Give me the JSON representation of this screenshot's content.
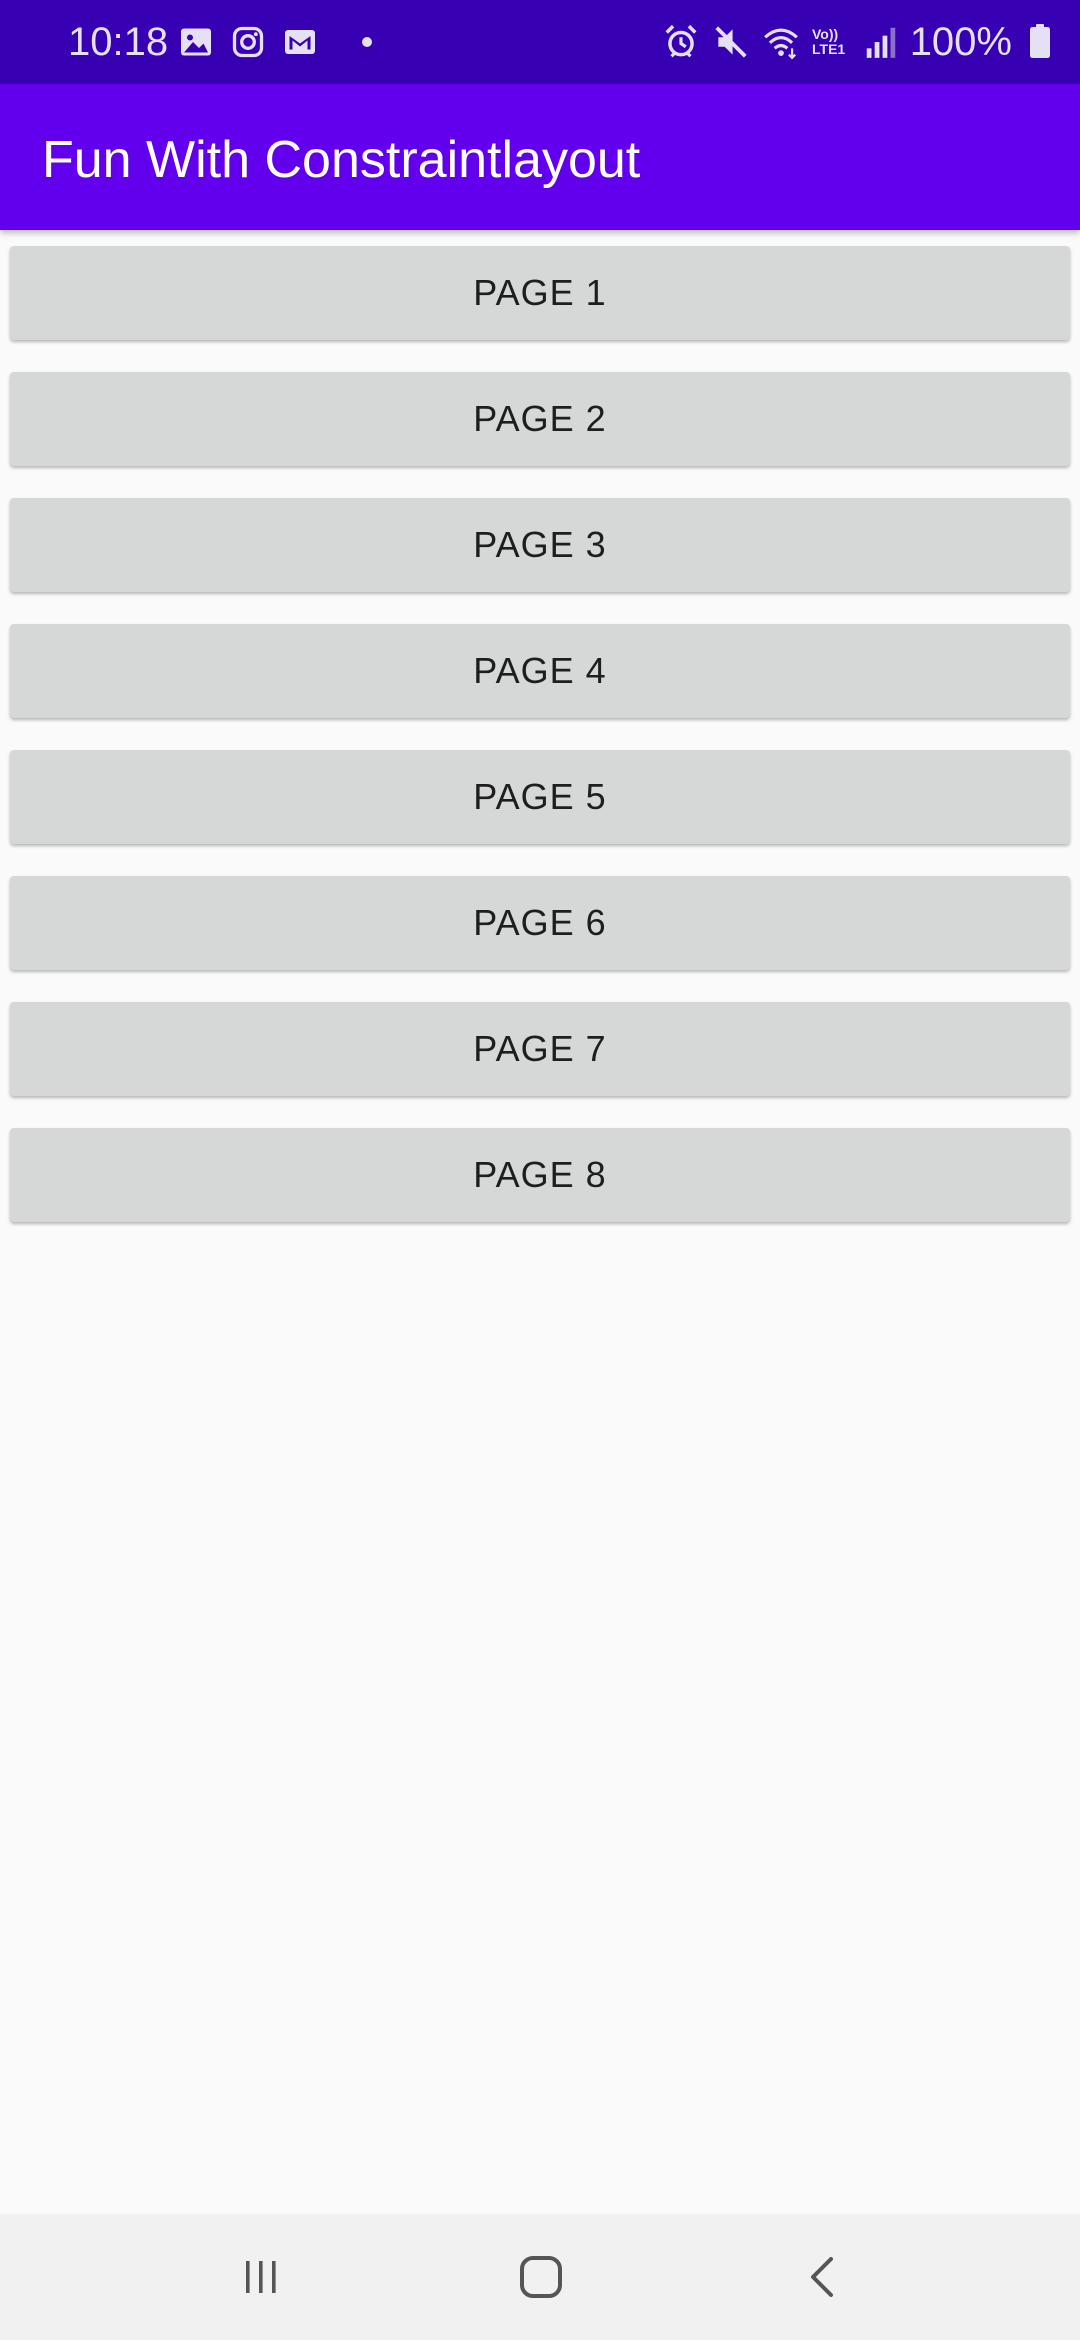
{
  "status_bar": {
    "time": "10:18",
    "left_icons": [
      "gallery-icon",
      "instagram-icon",
      "gmail-icon"
    ],
    "right_icons": [
      "alarm-icon",
      "mute-icon",
      "wifi-icon",
      "volte-icon",
      "signal-icon"
    ],
    "volte_top": "Vo))",
    "volte_bottom": "LTE1",
    "battery_percent": "100%"
  },
  "app_bar": {
    "title": "Fun With Constraintlayout"
  },
  "buttons": [
    {
      "label": "PAGE 1"
    },
    {
      "label": "PAGE 2"
    },
    {
      "label": "PAGE 3"
    },
    {
      "label": "PAGE 4"
    },
    {
      "label": "PAGE 5"
    },
    {
      "label": "PAGE 6"
    },
    {
      "label": "PAGE 7"
    },
    {
      "label": "PAGE 8"
    }
  ],
  "nav_bar": {
    "icons": [
      "recents-icon",
      "home-icon",
      "back-icon"
    ]
  },
  "colors": {
    "status_bar": "#3700b3",
    "app_bar": "#6200ee",
    "button_bg": "#d6d7d7",
    "background": "#fafafa",
    "nav_bar": "#f1f1f1"
  }
}
